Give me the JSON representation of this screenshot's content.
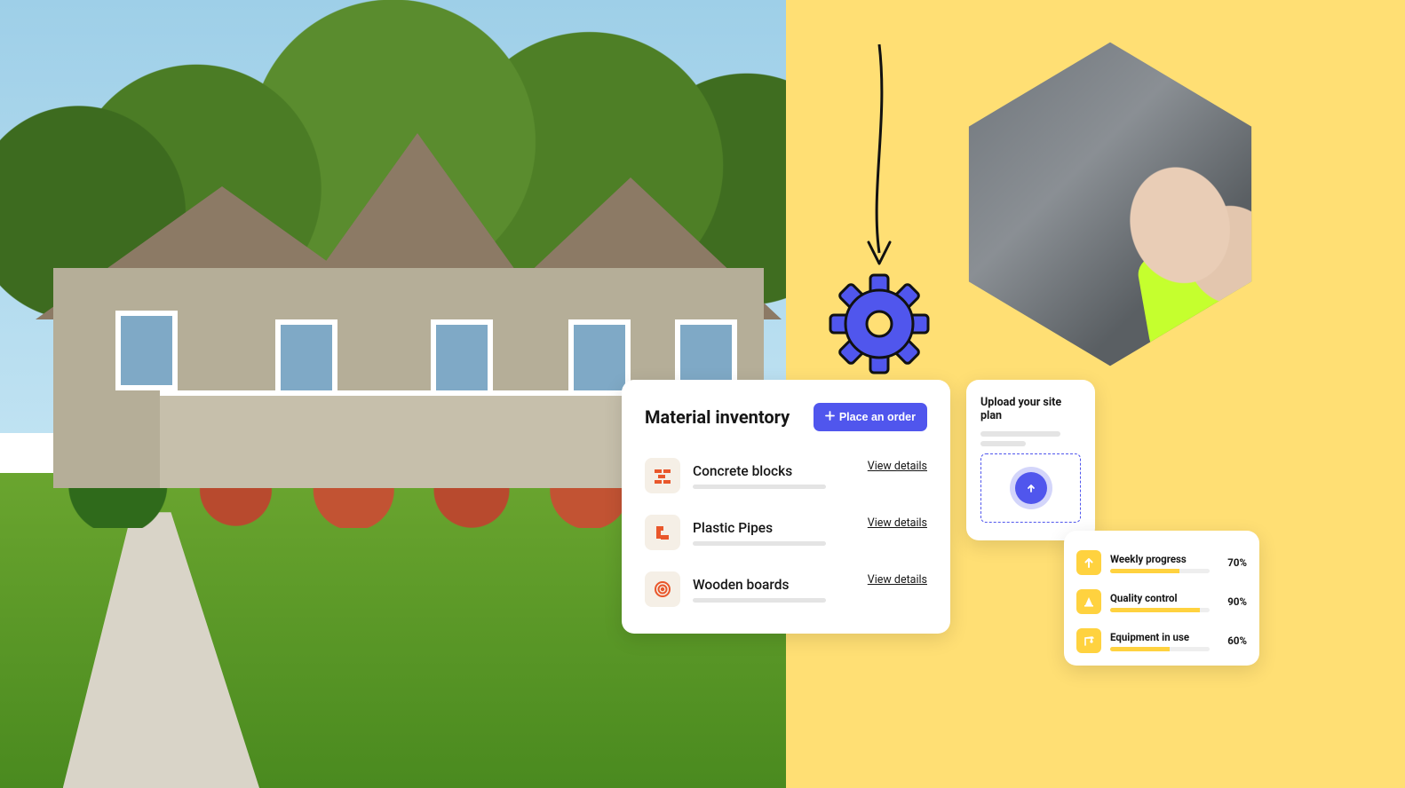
{
  "inventory": {
    "title": "Material inventory",
    "order_label": "Place an order",
    "view_label": "View details",
    "items": [
      {
        "name": "Concrete blocks",
        "icon": "bricks-icon"
      },
      {
        "name": "Plastic Pipes",
        "icon": "pipe-icon"
      },
      {
        "name": "Wooden boards",
        "icon": "wood-icon"
      }
    ]
  },
  "upload": {
    "title": "Upload your site plan"
  },
  "stats": {
    "items": [
      {
        "label": "Weekly progress",
        "pct": "70%",
        "fill": 70,
        "icon": "arrow-up-icon"
      },
      {
        "label": "Quality control",
        "pct": "90%",
        "fill": 90,
        "icon": "cone-icon"
      },
      {
        "label": "Equipment in use",
        "pct": "60%",
        "fill": 60,
        "icon": "crane-icon"
      }
    ]
  },
  "colors": {
    "accent": "#5056ED",
    "yellow": "#FFD23F",
    "orange": "#E9572B"
  }
}
